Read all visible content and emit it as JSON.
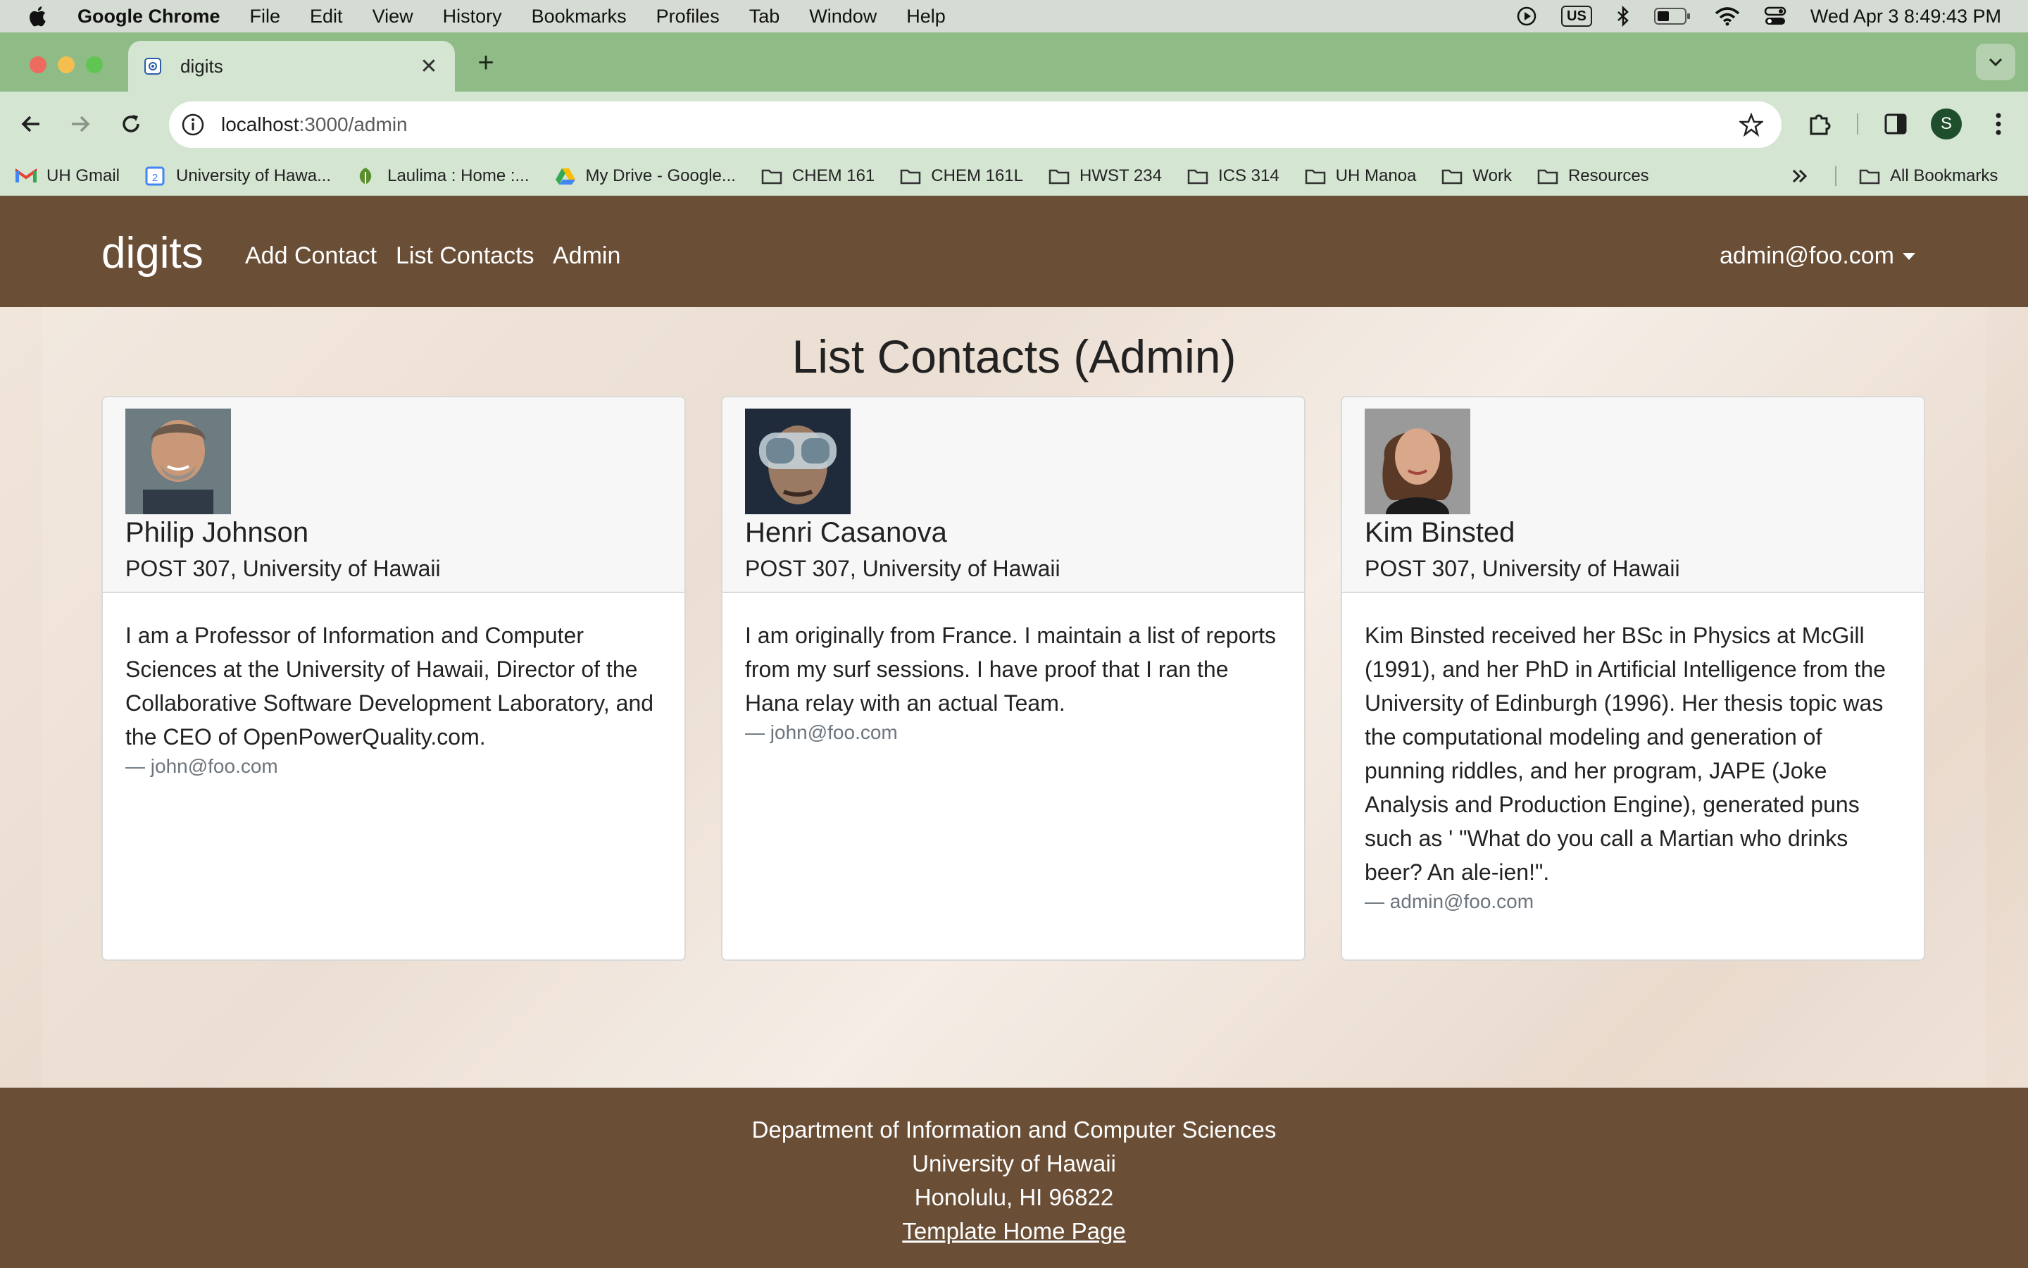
{
  "menubar": {
    "app": "Google Chrome",
    "items": [
      "File",
      "Edit",
      "View",
      "History",
      "Bookmarks",
      "Profiles",
      "Tab",
      "Window",
      "Help"
    ],
    "keyboard": "US",
    "clock": "Wed Apr 3  8:49:43 PM"
  },
  "browser": {
    "tab_title": "digits",
    "url_host": "localhost",
    "url_path": ":3000/admin",
    "profile_initial": "S",
    "bookmarks": [
      {
        "label": "UH Gmail",
        "icon": "gmail-icon"
      },
      {
        "label": "University of Hawa...",
        "icon": "calendar-icon"
      },
      {
        "label": "Laulima : Home :...",
        "icon": "leaf-icon"
      },
      {
        "label": "My Drive - Google...",
        "icon": "drive-icon"
      },
      {
        "label": "CHEM 161",
        "icon": "folder-icon"
      },
      {
        "label": "CHEM 161L",
        "icon": "folder-icon"
      },
      {
        "label": "HWST 234",
        "icon": "folder-icon"
      },
      {
        "label": "ICS 314",
        "icon": "folder-icon"
      },
      {
        "label": "UH Manoa",
        "icon": "folder-icon"
      },
      {
        "label": "Work",
        "icon": "folder-icon"
      },
      {
        "label": "Resources",
        "icon": "folder-icon"
      }
    ],
    "all_bookmarks": "All Bookmarks"
  },
  "navbar": {
    "brand": "digits",
    "links": [
      "Add Contact",
      "List Contacts",
      "Admin"
    ],
    "user": "admin@foo.com"
  },
  "main": {
    "title": "List Contacts (Admin)",
    "contacts": [
      {
        "name": "Philip Johnson",
        "address": "POST 307, University of Hawaii",
        "description": "I am a Professor of Information and Computer Sciences at the University of Hawaii, Director of the Collaborative Software Development Laboratory, and the CEO of OpenPowerQuality.com.",
        "owner": "— john@foo.com"
      },
      {
        "name": "Henri Casanova",
        "address": "POST 307, University of Hawaii",
        "description": "I am originally from France. I maintain a list of reports from my surf sessions. I have proof that I ran the Hana relay with an actual Team.",
        "owner": "— john@foo.com"
      },
      {
        "name": "Kim Binsted",
        "address": "POST 307, University of Hawaii",
        "description": "Kim Binsted received her BSc in Physics at McGill (1991), and her PhD in Artificial Intelligence from the University of Edinburgh (1996). Her thesis topic was the computational modeling and generation of punning riddles, and her program, JAPE (Joke Analysis and Production Engine), generated puns such as ' \"What do you call a Martian who drinks beer? An ale-ien!\".",
        "owner": "— admin@foo.com"
      }
    ]
  },
  "footer": {
    "line1": "Department of Information and Computer Sciences",
    "line2": "University of Hawaii",
    "line3": "Honolulu, HI 96822",
    "link": "Template Home Page"
  },
  "colors": {
    "navbar": "#6a4e36",
    "tabstrip": "#8fbc86",
    "toolbar": "#d4e5d2"
  }
}
